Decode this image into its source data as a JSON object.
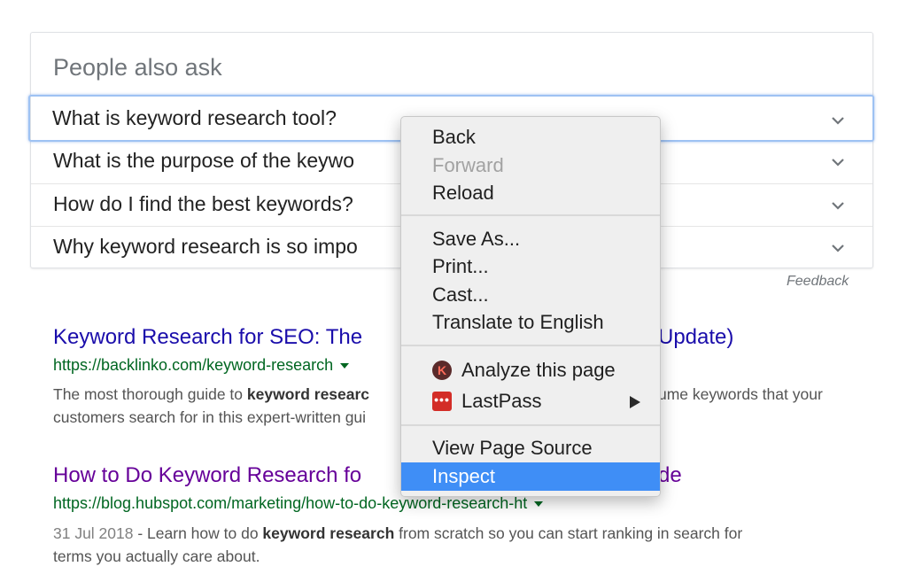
{
  "paa": {
    "title": "People also ask",
    "questions": [
      "What is keyword research tool?",
      "What is the purpose of the keywo",
      "How do I find the best keywords?",
      "Why keyword research is so impo"
    ],
    "feedback": "Feedback"
  },
  "results": [
    {
      "title_left": "Keyword Research for SEO: The",
      "title_right": "Update)",
      "url": "https://backlinko.com/keyword-research",
      "snippet": {
        "pre": "The most thorough guide to ",
        "bold": "keyword researc",
        "right": "ume keywords that your",
        "line2": "customers search for in this expert-written gui"
      }
    },
    {
      "title_left": "How to Do Keyword Research fo",
      "title_right": "de",
      "url": "https://blog.hubspot.com/marketing/how-to-do-keyword-research-ht",
      "snippet": {
        "date": "31 Jul 2018",
        "pre": " - Learn how to do ",
        "bold": "keyword research",
        "post": " from scratch so you can start ranking in search for",
        "line2": "terms you actually care about."
      }
    }
  ],
  "context_menu": {
    "items": {
      "back": "Back",
      "forward": "Forward",
      "reload": "Reload",
      "save_as": "Save As...",
      "print": "Print...",
      "cast": "Cast...",
      "translate": "Translate to English",
      "analyze": "Analyze this page",
      "lastpass": "LastPass",
      "view_source": "View Page Source",
      "inspect": "Inspect"
    },
    "icons": {
      "analyze": "k-extension-icon",
      "analyze_letter": "K",
      "lastpass": "lastpass-icon",
      "lastpass_glyph": "•••"
    }
  },
  "colors": {
    "link": "#1a0dab",
    "visited": "#660099",
    "url": "#006621",
    "menu_highlight": "#3f8ef6"
  }
}
